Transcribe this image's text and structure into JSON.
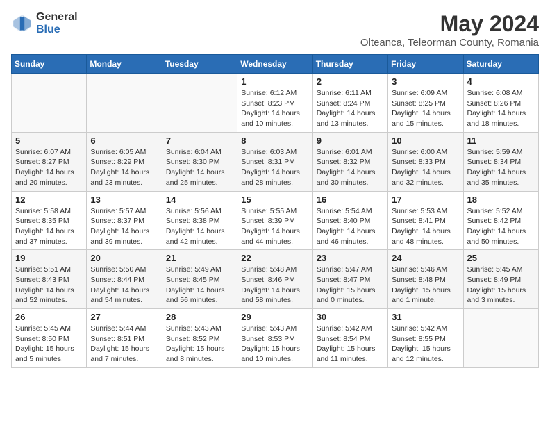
{
  "header": {
    "logo_general": "General",
    "logo_blue": "Blue",
    "month_year": "May 2024",
    "location": "Olteanca, Teleorman County, Romania"
  },
  "days_of_week": [
    "Sunday",
    "Monday",
    "Tuesday",
    "Wednesday",
    "Thursday",
    "Friday",
    "Saturday"
  ],
  "weeks": [
    [
      {
        "day": "",
        "info": ""
      },
      {
        "day": "",
        "info": ""
      },
      {
        "day": "",
        "info": ""
      },
      {
        "day": "1",
        "info": "Sunrise: 6:12 AM\nSunset: 8:23 PM\nDaylight: 14 hours\nand 10 minutes."
      },
      {
        "day": "2",
        "info": "Sunrise: 6:11 AM\nSunset: 8:24 PM\nDaylight: 14 hours\nand 13 minutes."
      },
      {
        "day": "3",
        "info": "Sunrise: 6:09 AM\nSunset: 8:25 PM\nDaylight: 14 hours\nand 15 minutes."
      },
      {
        "day": "4",
        "info": "Sunrise: 6:08 AM\nSunset: 8:26 PM\nDaylight: 14 hours\nand 18 minutes."
      }
    ],
    [
      {
        "day": "5",
        "info": "Sunrise: 6:07 AM\nSunset: 8:27 PM\nDaylight: 14 hours\nand 20 minutes."
      },
      {
        "day": "6",
        "info": "Sunrise: 6:05 AM\nSunset: 8:29 PM\nDaylight: 14 hours\nand 23 minutes."
      },
      {
        "day": "7",
        "info": "Sunrise: 6:04 AM\nSunset: 8:30 PM\nDaylight: 14 hours\nand 25 minutes."
      },
      {
        "day": "8",
        "info": "Sunrise: 6:03 AM\nSunset: 8:31 PM\nDaylight: 14 hours\nand 28 minutes."
      },
      {
        "day": "9",
        "info": "Sunrise: 6:01 AM\nSunset: 8:32 PM\nDaylight: 14 hours\nand 30 minutes."
      },
      {
        "day": "10",
        "info": "Sunrise: 6:00 AM\nSunset: 8:33 PM\nDaylight: 14 hours\nand 32 minutes."
      },
      {
        "day": "11",
        "info": "Sunrise: 5:59 AM\nSunset: 8:34 PM\nDaylight: 14 hours\nand 35 minutes."
      }
    ],
    [
      {
        "day": "12",
        "info": "Sunrise: 5:58 AM\nSunset: 8:35 PM\nDaylight: 14 hours\nand 37 minutes."
      },
      {
        "day": "13",
        "info": "Sunrise: 5:57 AM\nSunset: 8:37 PM\nDaylight: 14 hours\nand 39 minutes."
      },
      {
        "day": "14",
        "info": "Sunrise: 5:56 AM\nSunset: 8:38 PM\nDaylight: 14 hours\nand 42 minutes."
      },
      {
        "day": "15",
        "info": "Sunrise: 5:55 AM\nSunset: 8:39 PM\nDaylight: 14 hours\nand 44 minutes."
      },
      {
        "day": "16",
        "info": "Sunrise: 5:54 AM\nSunset: 8:40 PM\nDaylight: 14 hours\nand 46 minutes."
      },
      {
        "day": "17",
        "info": "Sunrise: 5:53 AM\nSunset: 8:41 PM\nDaylight: 14 hours\nand 48 minutes."
      },
      {
        "day": "18",
        "info": "Sunrise: 5:52 AM\nSunset: 8:42 PM\nDaylight: 14 hours\nand 50 minutes."
      }
    ],
    [
      {
        "day": "19",
        "info": "Sunrise: 5:51 AM\nSunset: 8:43 PM\nDaylight: 14 hours\nand 52 minutes."
      },
      {
        "day": "20",
        "info": "Sunrise: 5:50 AM\nSunset: 8:44 PM\nDaylight: 14 hours\nand 54 minutes."
      },
      {
        "day": "21",
        "info": "Sunrise: 5:49 AM\nSunset: 8:45 PM\nDaylight: 14 hours\nand 56 minutes."
      },
      {
        "day": "22",
        "info": "Sunrise: 5:48 AM\nSunset: 8:46 PM\nDaylight: 14 hours\nand 58 minutes."
      },
      {
        "day": "23",
        "info": "Sunrise: 5:47 AM\nSunset: 8:47 PM\nDaylight: 15 hours\nand 0 minutes."
      },
      {
        "day": "24",
        "info": "Sunrise: 5:46 AM\nSunset: 8:48 PM\nDaylight: 15 hours\nand 1 minute."
      },
      {
        "day": "25",
        "info": "Sunrise: 5:45 AM\nSunset: 8:49 PM\nDaylight: 15 hours\nand 3 minutes."
      }
    ],
    [
      {
        "day": "26",
        "info": "Sunrise: 5:45 AM\nSunset: 8:50 PM\nDaylight: 15 hours\nand 5 minutes."
      },
      {
        "day": "27",
        "info": "Sunrise: 5:44 AM\nSunset: 8:51 PM\nDaylight: 15 hours\nand 7 minutes."
      },
      {
        "day": "28",
        "info": "Sunrise: 5:43 AM\nSunset: 8:52 PM\nDaylight: 15 hours\nand 8 minutes."
      },
      {
        "day": "29",
        "info": "Sunrise: 5:43 AM\nSunset: 8:53 PM\nDaylight: 15 hours\nand 10 minutes."
      },
      {
        "day": "30",
        "info": "Sunrise: 5:42 AM\nSunset: 8:54 PM\nDaylight: 15 hours\nand 11 minutes."
      },
      {
        "day": "31",
        "info": "Sunrise: 5:42 AM\nSunset: 8:55 PM\nDaylight: 15 hours\nand 12 minutes."
      },
      {
        "day": "",
        "info": ""
      }
    ]
  ]
}
